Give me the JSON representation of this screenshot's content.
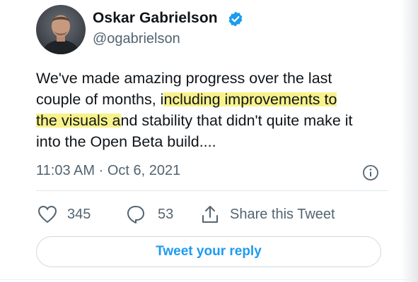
{
  "author": {
    "name": "Oskar Gabrielson",
    "handle": "@ogabrielson",
    "verified": true,
    "avatar_icon": "person-photo"
  },
  "tweet": {
    "line1": "We've made amazing progress over the last",
    "line2_pre": "couple of months, i",
    "line2_hl": "ncluding improvements to",
    "line3_hl": "the visuals a",
    "line3_post": "nd stability that didn't quite make it",
    "line4": "into the Open Beta build...."
  },
  "meta": {
    "time": "11:03 AM",
    "separator": "·",
    "date": "Oct 6, 2021"
  },
  "actions": {
    "like_count": "345",
    "reply_count": "53",
    "share_label": "Share this Tweet"
  },
  "reply_button": {
    "label": "Tweet your reply"
  },
  "colors": {
    "accent": "#1d9bf0",
    "secondary_text": "#536471",
    "highlight": "#f7f078"
  }
}
